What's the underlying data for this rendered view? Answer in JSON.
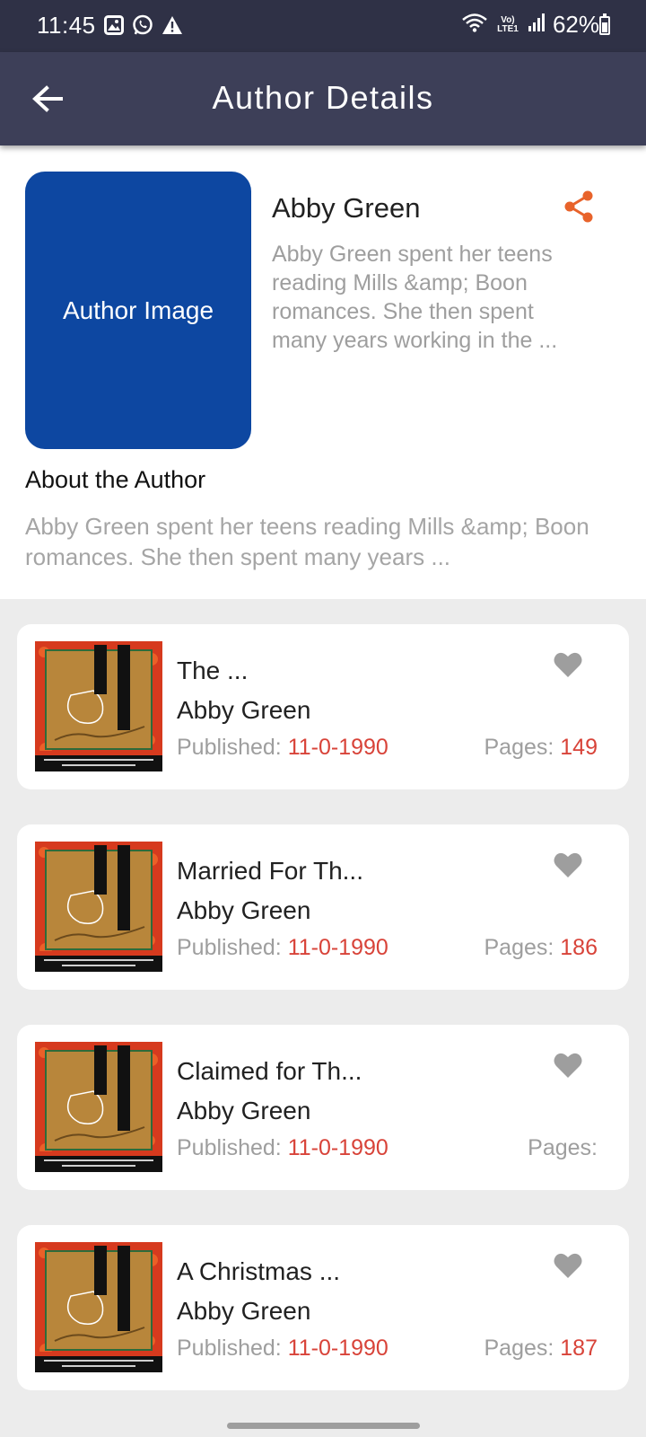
{
  "status_bar": {
    "time": "11:45",
    "left_icons": [
      "image-icon",
      "whatsapp-icon",
      "warning-icon"
    ],
    "network_label": "Vo) LTE1",
    "battery": "62%"
  },
  "app_bar": {
    "title": "Author Details",
    "back_icon": "arrow-back-icon"
  },
  "author": {
    "image_placeholder": "Author Image",
    "name": "Abby Green",
    "bio_short": "Abby Green spent her teens reading Mills &amp; Boon romances. She then spent many years working in the ...",
    "about_heading": "About the Author",
    "about_text": "Abby Green spent her teens reading Mills &amp; Boon romances. She then spent many years ...",
    "share_icon": "share-icon"
  },
  "book_labels": {
    "published": "Published: ",
    "pages": "Pages: "
  },
  "books": [
    {
      "title": "The ...",
      "author": "Abby Green",
      "published": "11-0-1990",
      "pages": "149"
    },
    {
      "title": "Married For Th...",
      "author": "Abby Green",
      "published": "11-0-1990",
      "pages": "186"
    },
    {
      "title": "Claimed for Th...",
      "author": "Abby Green",
      "published": "11-0-1990",
      "pages": ""
    },
    {
      "title": "A Christmas ...",
      "author": "Abby Green",
      "published": "11-0-1990",
      "pages": "187"
    }
  ],
  "colors": {
    "status_bar": "#2f3146",
    "app_bar": "#3d3f58",
    "author_image": "#0d47a1",
    "accent": "#d84339",
    "share": "#e8632b",
    "heart": "#9e9e9e"
  }
}
